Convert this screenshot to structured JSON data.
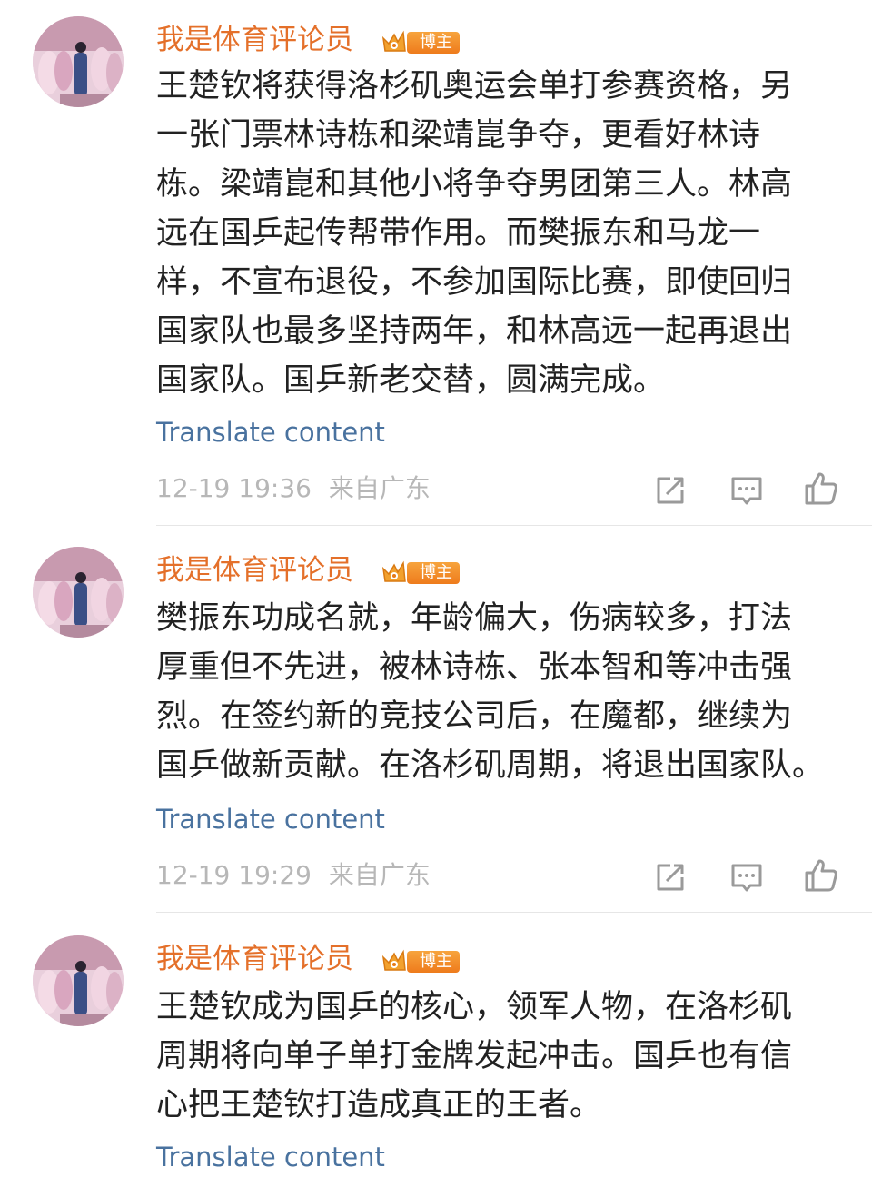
{
  "comments": [
    {
      "username": "我是体育评论员",
      "badge": "博主",
      "lines": [
        "王楚钦将获得洛杉矶奥运会单打参赛资格，另",
        "一张门票林诗栋和梁靖崑争夺，更看好林诗",
        "栋。梁靖崑和其他小将争夺男团第三人。林高",
        "远在国乒起传帮带作用。而樊振东和马龙一",
        "样，不宣布退役，不参加国际比赛，即使回归",
        "国家队也最多坚持两年，和林高远一起再退出",
        "国家队。国乒新老交替，圆满完成。"
      ],
      "translate": "Translate content",
      "time": "12-19 19:36",
      "location": "来自广东"
    },
    {
      "username": "我是体育评论员",
      "badge": "博主",
      "lines": [
        "樊振东功成名就，年龄偏大，伤病较多，打法",
        "厚重但不先进，被林诗栋、张本智和等冲击强",
        "烈。在签约新的竞技公司后，在魔都，继续为",
        "国乒做新贡献。在洛杉矶周期，将退出国家队。"
      ],
      "translate": "Translate content",
      "time": "12-19 19:29",
      "location": "来自广东"
    },
    {
      "username": "我是体育评论员",
      "badge": "博主",
      "lines": [
        "王楚钦成为国乒的核心，领军人物，在洛杉矶",
        "周期将向单子单打金牌发起冲击。国乒也有信",
        "心把王楚钦打造成真正的王者。"
      ],
      "translate": "Translate content"
    }
  ],
  "icons": {
    "share": "share-icon",
    "comment": "comment-icon",
    "like": "like-icon",
    "vip": "vip-crown-icon"
  },
  "colors": {
    "username": "#e4702a",
    "body_text": "#222222",
    "link": "#49729f",
    "meta": "#b7b7b7",
    "badge": "#f08a24",
    "icon": "#9a9a9a"
  }
}
